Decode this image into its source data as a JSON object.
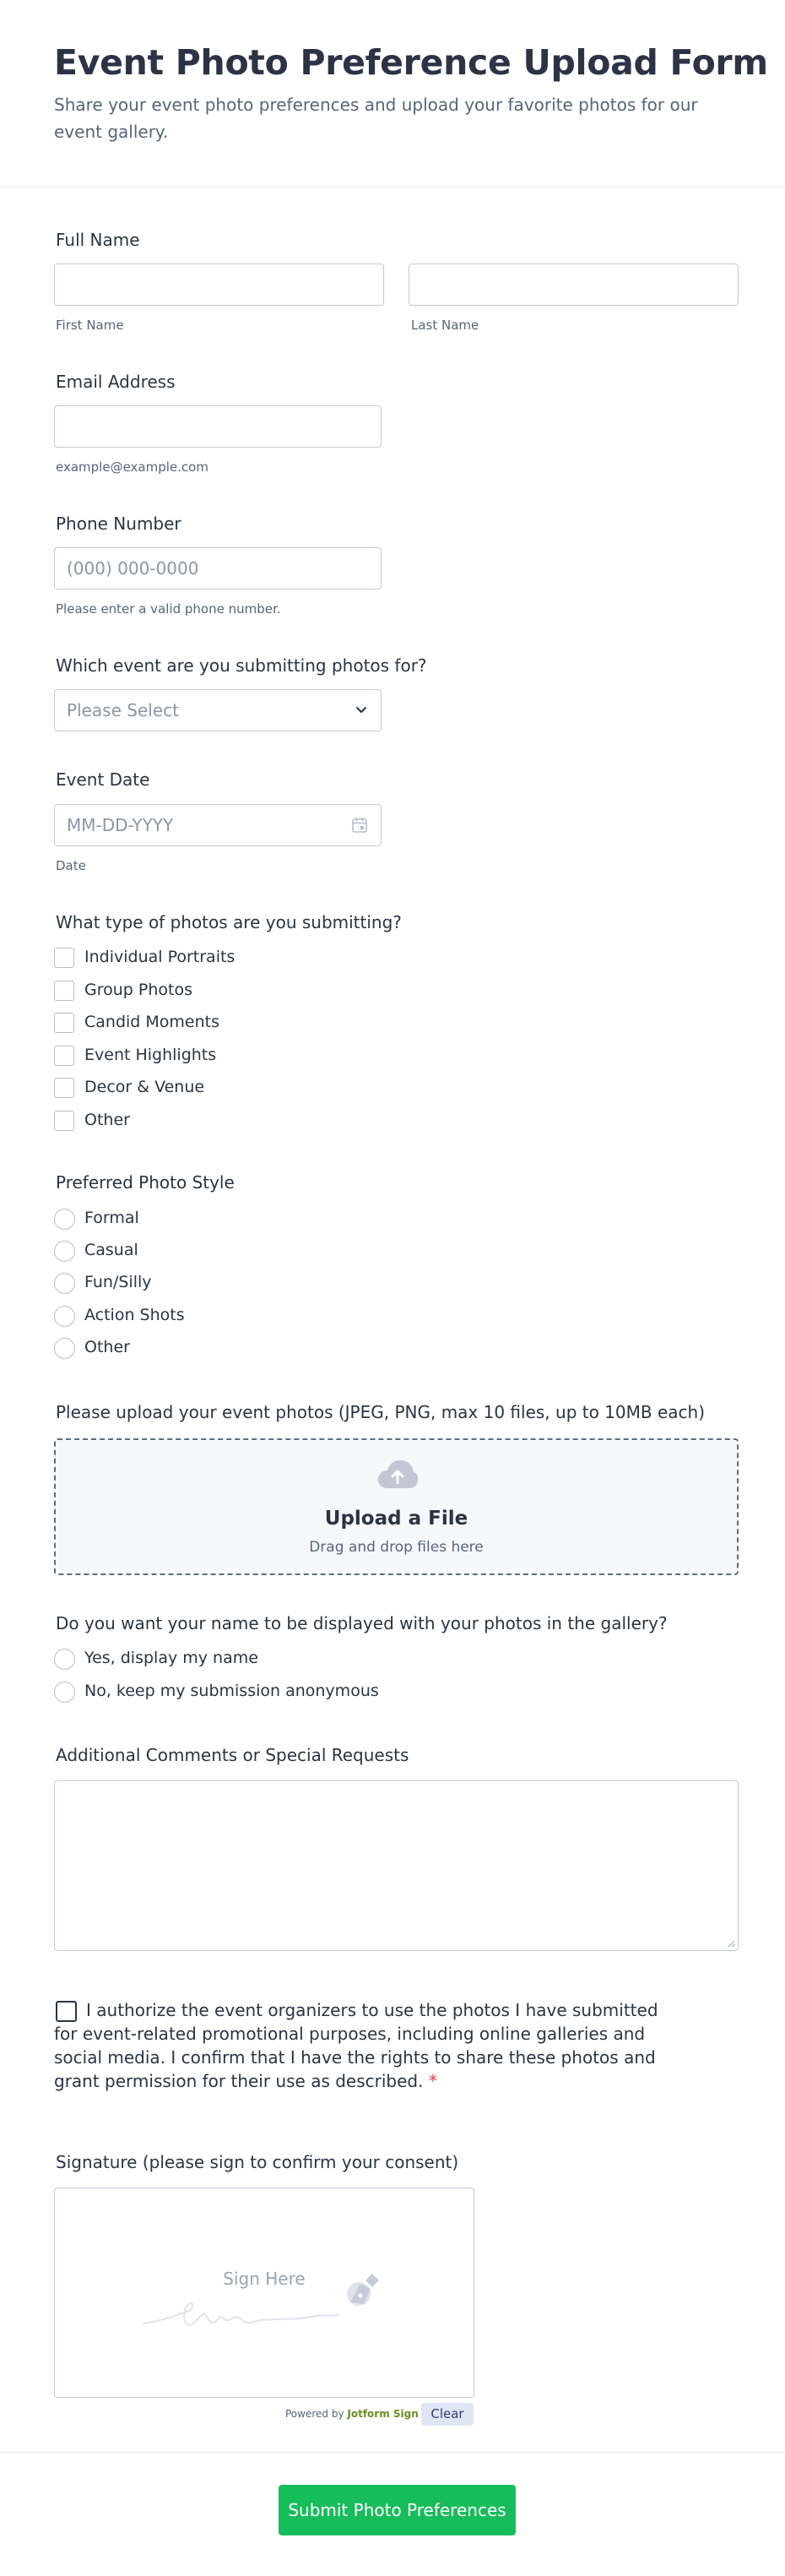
{
  "header": {
    "title": "Event Photo Preference Upload Form",
    "subtitle": "Share your event photo preferences and upload your favorite photos for our event gallery."
  },
  "full_name": {
    "label": "Full Name",
    "first_sublabel": "First Name",
    "last_sublabel": "Last Name"
  },
  "email": {
    "label": "Email Address",
    "sublabel": "example@example.com"
  },
  "phone": {
    "label": "Phone Number",
    "placeholder": "(000) 000-0000",
    "sublabel": "Please enter a valid phone number."
  },
  "event": {
    "label": "Which event are you submitting photos for?",
    "placeholder": "Please Select"
  },
  "event_date": {
    "label": "Event Date",
    "placeholder": "MM-DD-YYYY",
    "sublabel": "Date"
  },
  "photo_types": {
    "label": "What type of photos are you submitting?",
    "options": [
      "Individual Portraits",
      "Group Photos",
      "Candid Moments",
      "Event Highlights",
      "Decor & Venue",
      "Other"
    ]
  },
  "photo_style": {
    "label": "Preferred Photo Style",
    "options": [
      "Formal",
      "Casual",
      "Fun/Silly",
      "Action Shots",
      "Other"
    ]
  },
  "upload": {
    "label": "Please upload your event photos (JPEG, PNG, max 10 files, up to 10MB each)",
    "title": "Upload a File",
    "subtitle": "Drag and drop files here"
  },
  "display_name": {
    "label": "Do you want your name to be displayed with your photos in the gallery?",
    "options": [
      "Yes, display my name",
      "No, keep my submission anonymous"
    ]
  },
  "comments": {
    "label": "Additional Comments or Special Requests"
  },
  "consent": {
    "text": "I authorize the event organizers to use the photos I have submitted for event-related promotional purposes, including online galleries and social media. I confirm that I have the rights to share these photos and grant permission for their use as described.",
    "required_mark": "*"
  },
  "signature": {
    "label": "Signature (please sign to confirm your consent)",
    "placeholder": "Sign Here",
    "powered_prefix": "Powered by",
    "powered_brand": "Jotform Sign",
    "clear_label": "Clear"
  },
  "submit": {
    "label": "Submit Photo Preferences"
  },
  "colors": {
    "submit_bg": "#18bd5b",
    "text": "#2c3345",
    "sublabel": "#57647e",
    "required": "#e93a3a"
  }
}
